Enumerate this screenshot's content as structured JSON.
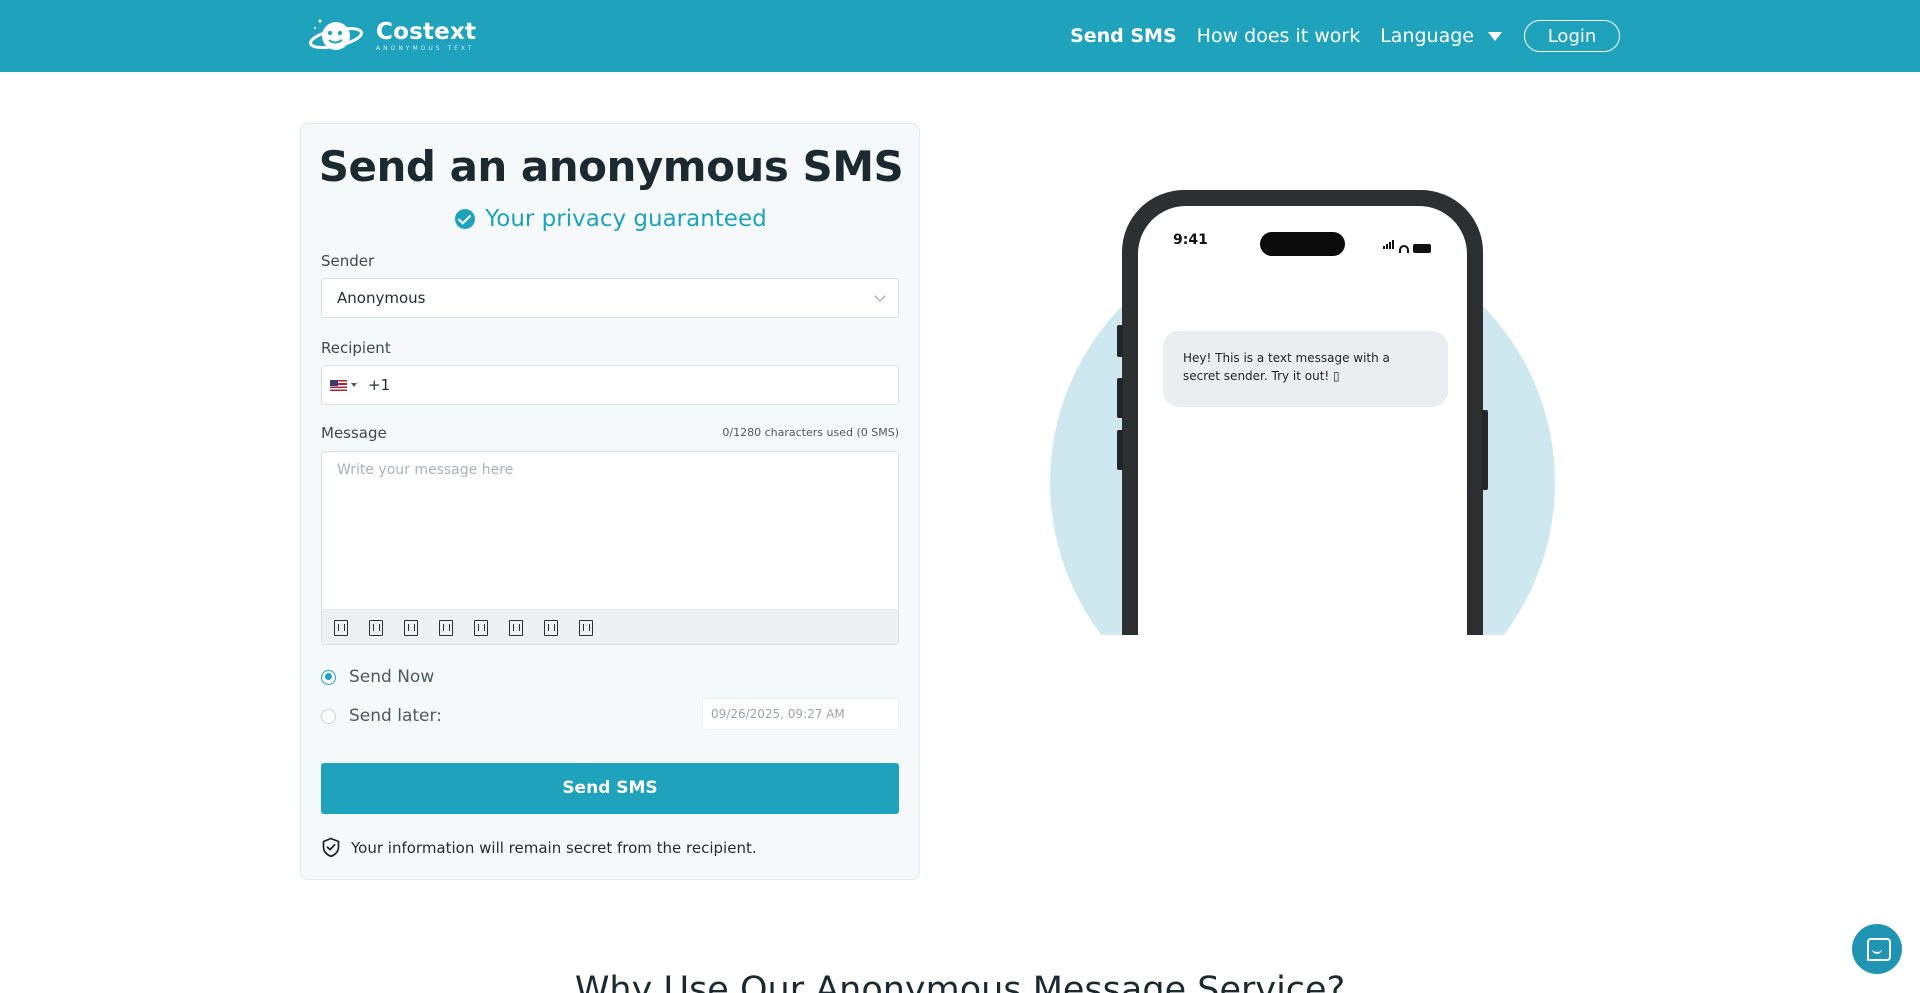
{
  "header": {
    "brand_name": "Costext",
    "brand_tagline": "ANONYMOUS TEXT",
    "nav": {
      "send_sms": "Send SMS",
      "how_it_works": "How does it work",
      "language": "Language",
      "login": "Login"
    }
  },
  "form": {
    "title": "Send an anonymous SMS",
    "privacy": "Your privacy guaranteed",
    "sender_label": "Sender",
    "sender_value": "Anonymous",
    "recipient_label": "Recipient",
    "dial_code": "+1",
    "message_label": "Message",
    "char_count": "0/1280 characters used (0 SMS)",
    "message_placeholder": "Write your message here",
    "send_now": "Send Now",
    "send_later": "Send later:",
    "scheduled_datetime": "09/26/2025, 09:27 AM",
    "submit": "Send SMS",
    "secret_note": "Your information will remain secret from the recipient."
  },
  "phone_preview": {
    "time": "9:41",
    "message": "Hey! This is a text message with a secret sender. Try it out! ▯"
  },
  "section_heading": "Why Use Our Anonymous Message Service?",
  "colors": {
    "brand": "#1fa2bb",
    "circle": "#cde9ef",
    "card_bg": "#f6f9fa"
  }
}
